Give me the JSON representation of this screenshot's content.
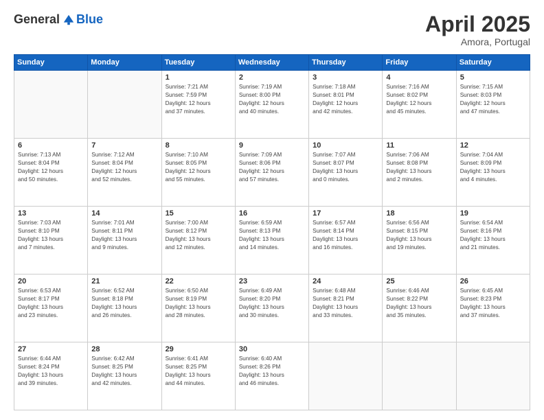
{
  "logo": {
    "general": "General",
    "blue": "Blue"
  },
  "title": "April 2025",
  "subtitle": "Amora, Portugal",
  "days_header": [
    "Sunday",
    "Monday",
    "Tuesday",
    "Wednesday",
    "Thursday",
    "Friday",
    "Saturday"
  ],
  "weeks": [
    [
      {
        "day": "",
        "info": ""
      },
      {
        "day": "",
        "info": ""
      },
      {
        "day": "1",
        "info": "Sunrise: 7:21 AM\nSunset: 7:59 PM\nDaylight: 12 hours\nand 37 minutes."
      },
      {
        "day": "2",
        "info": "Sunrise: 7:19 AM\nSunset: 8:00 PM\nDaylight: 12 hours\nand 40 minutes."
      },
      {
        "day": "3",
        "info": "Sunrise: 7:18 AM\nSunset: 8:01 PM\nDaylight: 12 hours\nand 42 minutes."
      },
      {
        "day": "4",
        "info": "Sunrise: 7:16 AM\nSunset: 8:02 PM\nDaylight: 12 hours\nand 45 minutes."
      },
      {
        "day": "5",
        "info": "Sunrise: 7:15 AM\nSunset: 8:03 PM\nDaylight: 12 hours\nand 47 minutes."
      }
    ],
    [
      {
        "day": "6",
        "info": "Sunrise: 7:13 AM\nSunset: 8:04 PM\nDaylight: 12 hours\nand 50 minutes."
      },
      {
        "day": "7",
        "info": "Sunrise: 7:12 AM\nSunset: 8:04 PM\nDaylight: 12 hours\nand 52 minutes."
      },
      {
        "day": "8",
        "info": "Sunrise: 7:10 AM\nSunset: 8:05 PM\nDaylight: 12 hours\nand 55 minutes."
      },
      {
        "day": "9",
        "info": "Sunrise: 7:09 AM\nSunset: 8:06 PM\nDaylight: 12 hours\nand 57 minutes."
      },
      {
        "day": "10",
        "info": "Sunrise: 7:07 AM\nSunset: 8:07 PM\nDaylight: 13 hours\nand 0 minutes."
      },
      {
        "day": "11",
        "info": "Sunrise: 7:06 AM\nSunset: 8:08 PM\nDaylight: 13 hours\nand 2 minutes."
      },
      {
        "day": "12",
        "info": "Sunrise: 7:04 AM\nSunset: 8:09 PM\nDaylight: 13 hours\nand 4 minutes."
      }
    ],
    [
      {
        "day": "13",
        "info": "Sunrise: 7:03 AM\nSunset: 8:10 PM\nDaylight: 13 hours\nand 7 minutes."
      },
      {
        "day": "14",
        "info": "Sunrise: 7:01 AM\nSunset: 8:11 PM\nDaylight: 13 hours\nand 9 minutes."
      },
      {
        "day": "15",
        "info": "Sunrise: 7:00 AM\nSunset: 8:12 PM\nDaylight: 13 hours\nand 12 minutes."
      },
      {
        "day": "16",
        "info": "Sunrise: 6:59 AM\nSunset: 8:13 PM\nDaylight: 13 hours\nand 14 minutes."
      },
      {
        "day": "17",
        "info": "Sunrise: 6:57 AM\nSunset: 8:14 PM\nDaylight: 13 hours\nand 16 minutes."
      },
      {
        "day": "18",
        "info": "Sunrise: 6:56 AM\nSunset: 8:15 PM\nDaylight: 13 hours\nand 19 minutes."
      },
      {
        "day": "19",
        "info": "Sunrise: 6:54 AM\nSunset: 8:16 PM\nDaylight: 13 hours\nand 21 minutes."
      }
    ],
    [
      {
        "day": "20",
        "info": "Sunrise: 6:53 AM\nSunset: 8:17 PM\nDaylight: 13 hours\nand 23 minutes."
      },
      {
        "day": "21",
        "info": "Sunrise: 6:52 AM\nSunset: 8:18 PM\nDaylight: 13 hours\nand 26 minutes."
      },
      {
        "day": "22",
        "info": "Sunrise: 6:50 AM\nSunset: 8:19 PM\nDaylight: 13 hours\nand 28 minutes."
      },
      {
        "day": "23",
        "info": "Sunrise: 6:49 AM\nSunset: 8:20 PM\nDaylight: 13 hours\nand 30 minutes."
      },
      {
        "day": "24",
        "info": "Sunrise: 6:48 AM\nSunset: 8:21 PM\nDaylight: 13 hours\nand 33 minutes."
      },
      {
        "day": "25",
        "info": "Sunrise: 6:46 AM\nSunset: 8:22 PM\nDaylight: 13 hours\nand 35 minutes."
      },
      {
        "day": "26",
        "info": "Sunrise: 6:45 AM\nSunset: 8:23 PM\nDaylight: 13 hours\nand 37 minutes."
      }
    ],
    [
      {
        "day": "27",
        "info": "Sunrise: 6:44 AM\nSunset: 8:24 PM\nDaylight: 13 hours\nand 39 minutes."
      },
      {
        "day": "28",
        "info": "Sunrise: 6:42 AM\nSunset: 8:25 PM\nDaylight: 13 hours\nand 42 minutes."
      },
      {
        "day": "29",
        "info": "Sunrise: 6:41 AM\nSunset: 8:25 PM\nDaylight: 13 hours\nand 44 minutes."
      },
      {
        "day": "30",
        "info": "Sunrise: 6:40 AM\nSunset: 8:26 PM\nDaylight: 13 hours\nand 46 minutes."
      },
      {
        "day": "",
        "info": ""
      },
      {
        "day": "",
        "info": ""
      },
      {
        "day": "",
        "info": ""
      }
    ]
  ]
}
